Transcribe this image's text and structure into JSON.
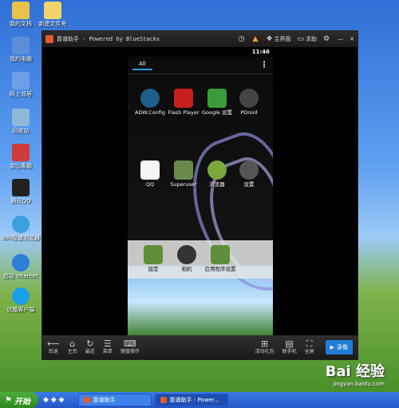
{
  "desktop": {
    "icons": [
      {
        "label": "我的文档",
        "color": "#e8c34a"
      },
      {
        "label": "新建文件夹",
        "color": "#f2d36b"
      },
      {
        "label": "我的电脑",
        "color": "#5a8fd8"
      },
      {
        "label": "网上邻居",
        "color": "#6ba0e8"
      },
      {
        "label": "回收站",
        "color": "#8fb8d8"
      },
      {
        "label": "金山毒霸",
        "color": "#d03a3a"
      },
      {
        "label": "腾讯QQ",
        "color": "#222222"
      },
      {
        "label": "360极速浏览器",
        "color": "#3aa0e0"
      },
      {
        "label": "启动 Internet",
        "color": "#2d7fd8"
      },
      {
        "label": "优酷客户端",
        "color": "#1aa0e8"
      }
    ]
  },
  "window": {
    "title": "靠谱助手 - Powered by BlueStacks",
    "toolbar": {
      "home_label": "主界面",
      "help_label": "求助",
      "minimize_label": "—",
      "close_label": "✕"
    },
    "android": {
      "time": "11:46",
      "tab_all": "All",
      "apps_row1": [
        "ADW.Config",
        "Flash Player",
        "Google 设置",
        "PDroid"
      ],
      "apps_row2": [
        "QQ",
        "Superuser",
        "浏览器",
        "设置"
      ],
      "dock_apps": [
        "設定",
        "相机",
        "应用程序设置"
      ],
      "colors": {
        "flash": "#c81e1e",
        "google": "#3a9b3a",
        "qq": "#f5c400"
      }
    },
    "bottom_toolbar": {
      "back": "后退",
      "home": "主页",
      "recent": "最近",
      "menu": "菜单",
      "keyboard": "键盘操作",
      "gift": "活动礼包",
      "phone": "联手机",
      "fullscreen": "全屏",
      "record": "录像"
    }
  },
  "taskbar": {
    "start_label": "开始",
    "tasks": [
      "靠谱助手",
      "靠谱助手 - Power..."
    ]
  },
  "watermark": {
    "brand": "Bai 经验",
    "url": "jingyan.baidu.com"
  }
}
